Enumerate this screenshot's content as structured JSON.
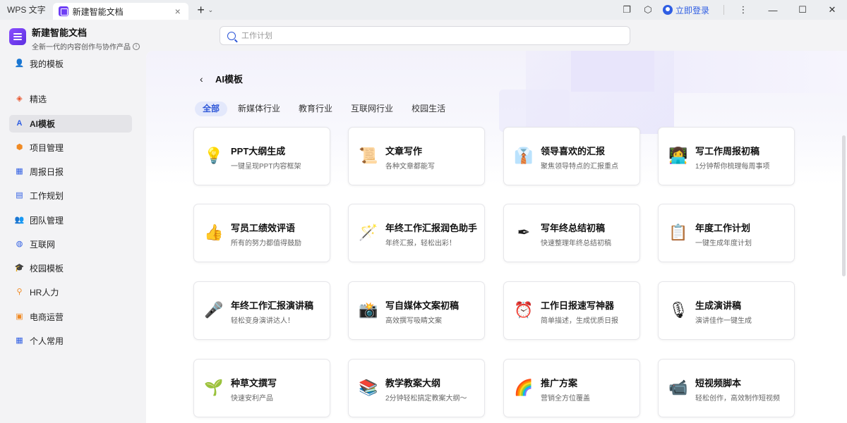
{
  "titlebar": {
    "app_name": "WPS 文字",
    "tab_label": "新建智能文档",
    "login_label": "立即登录"
  },
  "header": {
    "brand_title": "新建智能文档",
    "brand_subtitle": "全新一代的内容创作与协作产品",
    "search_placeholder": "工作计划"
  },
  "sidebar": {
    "items": [
      {
        "label": "我的模板",
        "icon": "user-icon"
      },
      {
        "label": "精选",
        "icon": "diamond-icon"
      },
      {
        "label": "AI模板",
        "icon": "ai-icon"
      },
      {
        "label": "项目管理",
        "icon": "box-icon"
      },
      {
        "label": "周报日报",
        "icon": "calendar-icon"
      },
      {
        "label": "工作规划",
        "icon": "document-icon"
      },
      {
        "label": "团队管理",
        "icon": "team-icon"
      },
      {
        "label": "互联网",
        "icon": "globe-icon"
      },
      {
        "label": "校园模板",
        "icon": "graduation-icon"
      },
      {
        "label": "HR人力",
        "icon": "person-icon"
      },
      {
        "label": "电商运营",
        "icon": "store-icon"
      },
      {
        "label": "个人常用",
        "icon": "grid-icon"
      }
    ],
    "active_index": 2
  },
  "main": {
    "page_title": "AI模板",
    "filters": [
      "全部",
      "新媒体行业",
      "教育行业",
      "互联网行业",
      "校园生活"
    ],
    "active_filter": 0,
    "cards": [
      {
        "title": "PPT大纲生成",
        "subtitle": "一键呈现PPT内容框架",
        "icon": "lightbulb-icon",
        "glyph": "💡"
      },
      {
        "title": "文章写作",
        "subtitle": "各种文章都能写",
        "icon": "scroll-icon",
        "glyph": "📜"
      },
      {
        "title": "领导喜欢的汇报",
        "subtitle": "聚焦领导特点的汇报重点",
        "icon": "shirt-tie-icon",
        "glyph": "👔"
      },
      {
        "title": "写工作周报初稿",
        "subtitle": "1分钟帮你梳理每周事项",
        "icon": "office-worker-icon",
        "glyph": "👩‍💻"
      },
      {
        "title": "写员工绩效评语",
        "subtitle": "所有的努力都值得鼓励",
        "icon": "thumbs-up-icon",
        "glyph": "👍"
      },
      {
        "title": "年终工作汇报润色助手",
        "subtitle": "年终汇报，轻松出彩！",
        "icon": "magic-wand-icon",
        "glyph": "🪄"
      },
      {
        "title": "写年终总结初稿",
        "subtitle": "快速整理年终总结初稿",
        "icon": "pen-icon",
        "glyph": "✒"
      },
      {
        "title": "年度工作计划",
        "subtitle": "一键生成年度计划",
        "icon": "clipboard-icon",
        "glyph": "📋"
      },
      {
        "title": "年终工作汇报演讲稿",
        "subtitle": "轻松变身演讲达人！",
        "icon": "microphone-icon",
        "glyph": "🎤"
      },
      {
        "title": "写自媒体文案初稿",
        "subtitle": "高效撰写吸睛文案",
        "icon": "camera-flash-icon",
        "glyph": "📸"
      },
      {
        "title": "工作日报速写神器",
        "subtitle": "简单描述，生成优质日报",
        "icon": "alarm-clock-icon",
        "glyph": "⏰"
      },
      {
        "title": "生成演讲稿",
        "subtitle": "演讲佳作一键生成",
        "icon": "studio-mic-icon",
        "glyph": "🎙"
      },
      {
        "title": "种草文撰写",
        "subtitle": "快速安利产品",
        "icon": "seedling-icon",
        "glyph": "🌱"
      },
      {
        "title": "教学教案大纲",
        "subtitle": "2分钟轻松搞定教案大纲～",
        "icon": "books-icon",
        "glyph": "📚"
      },
      {
        "title": "推广方案",
        "subtitle": "营销全方位覆盖",
        "icon": "rainbow-icon",
        "glyph": "🌈"
      },
      {
        "title": "短视频脚本",
        "subtitle": "轻松创作，高效制作短视频",
        "icon": "video-camera-icon",
        "glyph": "📹"
      }
    ]
  },
  "colors": {
    "accent": "#2e57d8",
    "brand": "#6f3ff5"
  }
}
